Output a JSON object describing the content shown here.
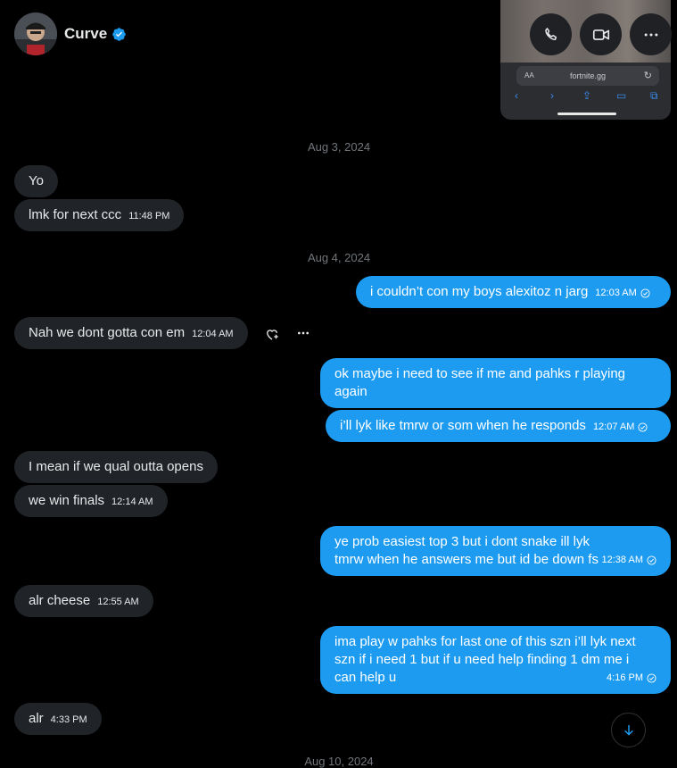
{
  "header": {
    "contact_name": "Curve",
    "verified": true,
    "accent": "#1d9bf0"
  },
  "pip": {
    "text_size": "AA",
    "url": "fortnite.gg"
  },
  "call_buttons": {
    "voice": "phone-icon",
    "video": "video-icon",
    "more": "more-icon"
  },
  "dates": {
    "d1": "Aug 3, 2024",
    "d2": "Aug 4, 2024",
    "d3": "Aug 10, 2024"
  },
  "messages": [
    {
      "text": "Yo",
      "time": ""
    },
    {
      "text": "lmk for next ccc",
      "time": "11:48 PM"
    },
    {
      "text": "i couldn’t con my boys alexitoz n jarg",
      "time": "12:03 AM"
    },
    {
      "text": "Nah we dont gotta con em",
      "time": "12:04 AM"
    },
    {
      "text": "ok maybe i need to see if me and pahks r playing again",
      "time": ""
    },
    {
      "text": "i’ll lyk like tmrw or som when he responds",
      "time": "12:07 AM"
    },
    {
      "text": "I mean if we qual outta opens",
      "time": ""
    },
    {
      "text": "we win finals",
      "time": "12:14 AM"
    },
    {
      "text": "ye prob easiest top 3  but i dont snake ill lyk tmrw when he answers me but id be down fs",
      "time": "12:38 AM"
    },
    {
      "text": "alr cheese",
      "time": "12:55 AM"
    },
    {
      "text": "ima play w pahks for last one of this szn i’ll lyk next szn if i need 1 but if u need help finding 1 dm me i can help u",
      "time": "4:16 PM"
    },
    {
      "text": "alr",
      "time": "4:33 PM"
    }
  ]
}
